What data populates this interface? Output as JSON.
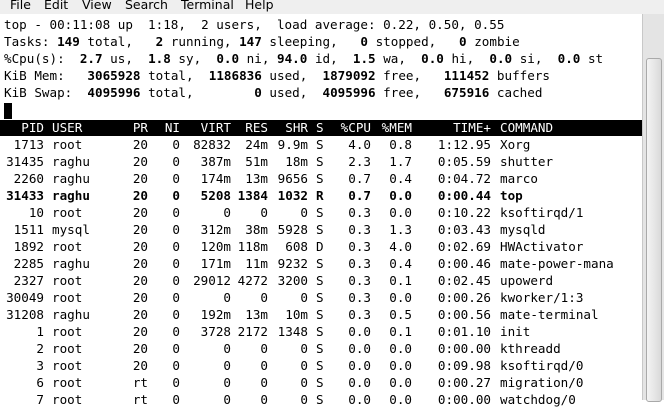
{
  "menu": [
    "File",
    "Edit",
    "View",
    "Search",
    "Terminal",
    "Help"
  ],
  "summary": {
    "line1": "top - 00:11:08 up  1:18,  2 users,  load average: 0.22, 0.50, 0.55",
    "tasks": {
      "label": "Tasks:",
      "total": "149",
      "running": "2",
      "sleeping": "147",
      "stopped": "0",
      "zombie": "0"
    },
    "cpu": {
      "label": "%Cpu(s):",
      "us": "2.7",
      "sy": "1.8",
      "ni": "0.0",
      "id": "94.0",
      "wa": "1.5",
      "hi": "0.0",
      "si": "0.0",
      "st": "0.0"
    },
    "mem": {
      "label": "KiB Mem:",
      "total": "3065928",
      "used": "1186836",
      "free": "1879092",
      "buffers": "111452"
    },
    "swap": {
      "label": "KiB Swap:",
      "total": "4095996",
      "used": "0",
      "free": "4095996",
      "cached": "675916"
    }
  },
  "columns": [
    "PID",
    "USER",
    "PR",
    "NI",
    "VIRT",
    "RES",
    "SHR",
    "S",
    "%CPU",
    "%MEM",
    "TIME+",
    "COMMAND"
  ],
  "processes": [
    [
      "1713",
      "root",
      "20",
      "0",
      "82832",
      "24m",
      "9.9m",
      "S",
      "4.0",
      "0.8",
      "1:12.95",
      "Xorg"
    ],
    [
      "31435",
      "raghu",
      "20",
      "0",
      "387m",
      "51m",
      "18m",
      "S",
      "2.3",
      "1.7",
      "0:05.59",
      "shutter"
    ],
    [
      "2260",
      "raghu",
      "20",
      "0",
      "174m",
      "13m",
      "9656",
      "S",
      "0.7",
      "0.4",
      "0:04.72",
      "marco"
    ],
    [
      "31433",
      "raghu",
      "20",
      "0",
      "5208",
      "1384",
      "1032",
      "R",
      "0.7",
      "0.0",
      "0:00.44",
      "top"
    ],
    [
      "10",
      "root",
      "20",
      "0",
      "0",
      "0",
      "0",
      "S",
      "0.3",
      "0.0",
      "0:10.22",
      "ksoftirqd/1"
    ],
    [
      "1511",
      "mysql",
      "20",
      "0",
      "312m",
      "38m",
      "5928",
      "S",
      "0.3",
      "1.3",
      "0:03.43",
      "mysqld"
    ],
    [
      "1892",
      "root",
      "20",
      "0",
      "120m",
      "118m",
      "608",
      "D",
      "0.3",
      "4.0",
      "0:02.69",
      "HWActivator"
    ],
    [
      "2285",
      "raghu",
      "20",
      "0",
      "171m",
      "11m",
      "9232",
      "S",
      "0.3",
      "0.4",
      "0:00.46",
      "mate-power-mana"
    ],
    [
      "2327",
      "root",
      "20",
      "0",
      "29012",
      "4272",
      "3200",
      "S",
      "0.3",
      "0.1",
      "0:02.45",
      "upowerd"
    ],
    [
      "30049",
      "root",
      "20",
      "0",
      "0",
      "0",
      "0",
      "S",
      "0.3",
      "0.0",
      "0:00.26",
      "kworker/1:3"
    ],
    [
      "31208",
      "raghu",
      "20",
      "0",
      "192m",
      "13m",
      "10m",
      "S",
      "0.3",
      "0.5",
      "0:00.56",
      "mate-terminal"
    ],
    [
      "1",
      "root",
      "20",
      "0",
      "3728",
      "2172",
      "1348",
      "S",
      "0.0",
      "0.1",
      "0:01.10",
      "init"
    ],
    [
      "2",
      "root",
      "20",
      "0",
      "0",
      "0",
      "0",
      "S",
      "0.0",
      "0.0",
      "0:00.00",
      "kthreadd"
    ],
    [
      "3",
      "root",
      "20",
      "0",
      "0",
      "0",
      "0",
      "S",
      "0.0",
      "0.0",
      "0:09.98",
      "ksoftirqd/0"
    ],
    [
      "6",
      "root",
      "rt",
      "0",
      "0",
      "0",
      "0",
      "S",
      "0.0",
      "0.0",
      "0:00.27",
      "migration/0"
    ],
    [
      "7",
      "root",
      "rt",
      "0",
      "0",
      "0",
      "0",
      "S",
      "0.0",
      "0.0",
      "0:00.00",
      "watchdog/0"
    ]
  ],
  "highlighted_pid": "31433"
}
